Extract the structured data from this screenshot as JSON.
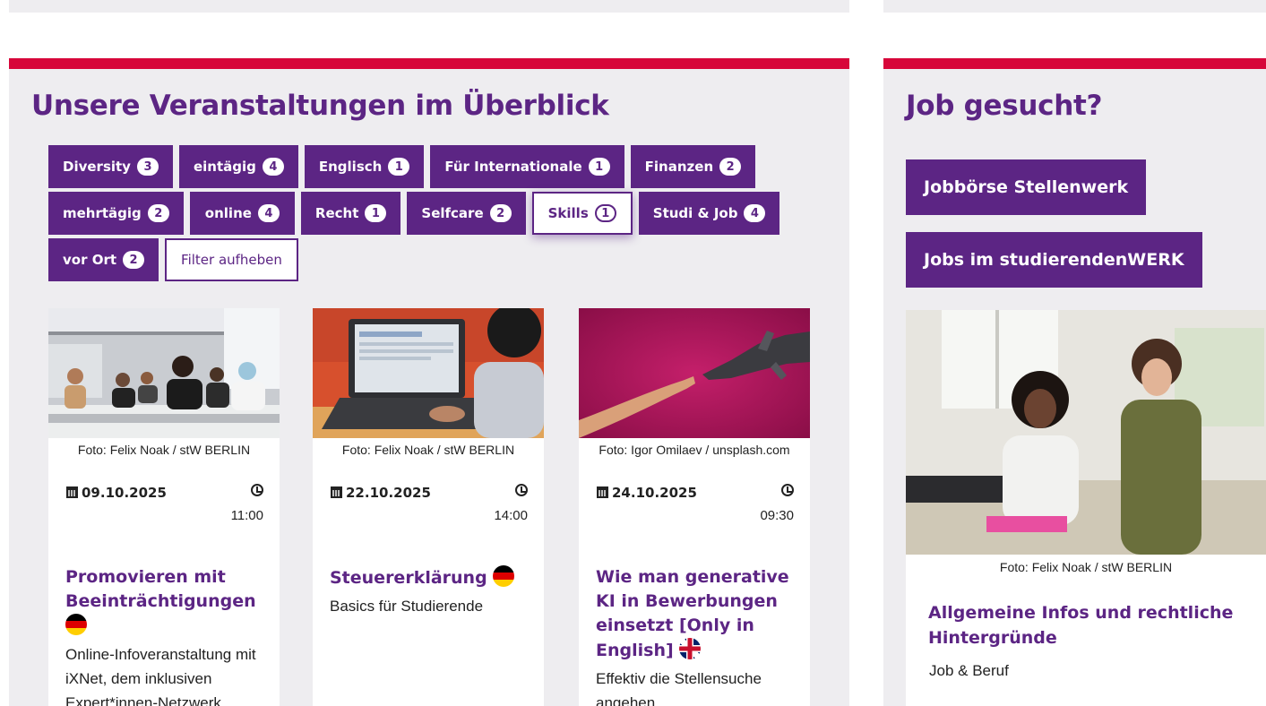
{
  "events": {
    "title": "Unsere Veranstaltungen im Überblick",
    "filter_rows": [
      [
        {
          "label": "Diversity",
          "count": "3"
        },
        {
          "label": "eintägig",
          "count": "4"
        },
        {
          "label": "Englisch",
          "count": "1"
        },
        {
          "label": "Für Internationale",
          "count": "1"
        },
        {
          "label": "Finanzen",
          "count": "2"
        }
      ],
      [
        {
          "label": "mehrtägig",
          "count": "2"
        },
        {
          "label": "online",
          "count": "4"
        },
        {
          "label": "Recht",
          "count": "1"
        },
        {
          "label": "Selfcare",
          "count": "2"
        },
        {
          "label": "Skills",
          "count": "1",
          "active": true
        },
        {
          "label": "Studi & Job",
          "count": "4"
        }
      ],
      [
        {
          "label": "vor Ort",
          "count": "2"
        }
      ]
    ],
    "reset_label": "Filter aufheben",
    "cards": [
      {
        "credit": "Foto: Felix Noak / stW BERLIN",
        "date": "09.10.2025",
        "time": "11:00",
        "title": "Promovieren mit Beeinträchtigungen",
        "flag": "de",
        "description": "Online-Infoveranstaltung mit iXNet, dem inklusiven Expert*innen-Netzwerk"
      },
      {
        "credit": "Foto: Felix Noak / stW BERLIN",
        "date": "22.10.2025",
        "time": "14:00",
        "title": "Steuererklärung",
        "flag": "de",
        "description": "Basics für Studierende"
      },
      {
        "credit": "Foto: Igor Omilaev / unsplash.com",
        "date": "24.10.2025",
        "time": "09:30",
        "title": "Wie man generative KI in Bewerbungen einsetzt [Only in English]",
        "flag": "uk",
        "description": "Effektiv die Stellensuche angehen"
      }
    ]
  },
  "jobs": {
    "title": "Job gesucht?",
    "button1": "Jobbörse Stellenwerk",
    "button2": "Jobs im studierendenWERK",
    "credit": "Foto: Felix Noak / stW BERLIN",
    "card_title": "Allgemeine Infos und rechtliche Hintergründe",
    "card_sub": "Job & Beruf"
  },
  "colors": {
    "accent": "#5c2584",
    "topbar": "#d7063a",
    "panel": "#eeedf0"
  },
  "icons": [
    "calendar-icon",
    "clock-icon",
    "german-flag-icon",
    "uk-flag-icon"
  ]
}
